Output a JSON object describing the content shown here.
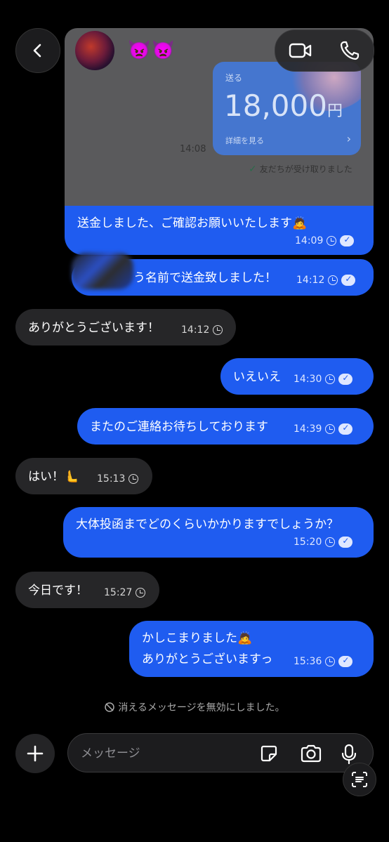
{
  "header": {
    "contact_emoji": "👿👿",
    "back_icon": "chevron-left-icon",
    "video_icon": "video-camera-icon",
    "phone_icon": "phone-icon"
  },
  "shared_transfer": {
    "label": "送る",
    "amount": "18,000",
    "currency": "円",
    "detail_link": "詳細を見る",
    "time": "14:08",
    "status": "友だちが受け取りました"
  },
  "messages": [
    {
      "dir": "out",
      "text": "送金しました、ご確認お願いいたします🙇",
      "time": "14:09"
    },
    {
      "dir": "out",
      "text": "う名前で送金致しました！",
      "time": "14:12"
    },
    {
      "dir": "in",
      "text": "ありがとうございます！",
      "time": "14:12"
    },
    {
      "dir": "out",
      "text": "いえいえ",
      "time": "14:30"
    },
    {
      "dir": "out",
      "text": "またのご連絡お待ちしております",
      "time": "14:39"
    },
    {
      "dir": "in",
      "text": "はい！🫷",
      "time": "15:13"
    },
    {
      "dir": "out",
      "text": "大体投函までどのくらいかかりますでしょうか？",
      "time": "15:20"
    },
    {
      "dir": "in",
      "text": "今日です！",
      "time": "15:27"
    },
    {
      "dir": "out",
      "text": "かしこまりました🙇",
      "text2": "ありがとうございますっ",
      "time": "15:36"
    }
  ],
  "notice": "消えるメッセージを無効にしました。",
  "composer": {
    "placeholder": "メッセージ",
    "icons": [
      "plus-icon",
      "sticker-icon",
      "camera-icon",
      "microphone-icon",
      "scan-text-icon"
    ]
  },
  "colors": {
    "outgoing_bubble": "#1f5cf0",
    "incoming_bubble": "#262628",
    "background": "#000000"
  }
}
